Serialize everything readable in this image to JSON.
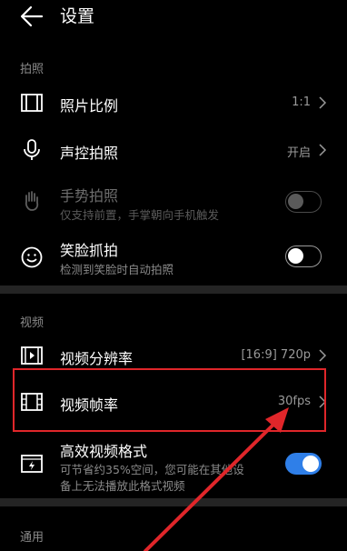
{
  "header": {
    "back_icon": "arrow-left-icon",
    "title": "设置"
  },
  "sections": {
    "photo": {
      "label": "拍照",
      "items": [
        {
          "icon": "aspect-ratio-icon",
          "title": "照片比例",
          "value": "1:1"
        },
        {
          "icon": "microphone-icon",
          "title": "声控拍照",
          "value": "开启"
        },
        {
          "icon": "gesture-hand-icon",
          "title": "手势拍照",
          "desc": "仅支持前置，手掌朝向手机触发",
          "toggle": "off",
          "disabled": true
        },
        {
          "icon": "smile-face-icon",
          "title": "笑脸抓拍",
          "desc": "检测到笑脸时自动拍照",
          "toggle": "off"
        }
      ]
    },
    "video": {
      "label": "视频",
      "items": [
        {
          "icon": "video-resolution-icon",
          "title": "视频分辨率",
          "value": "[16:9] 720p"
        },
        {
          "icon": "film-frame-icon",
          "title": "视频帧率",
          "value": "30fps"
        },
        {
          "icon": "efficient-format-icon",
          "title": "高效视频格式",
          "desc_line1": "可节省约35%空间，您可能在其他设",
          "desc_line2": "备上无法播放此格式视频",
          "toggle": "on"
        }
      ]
    },
    "general": {
      "label": "通用"
    }
  },
  "colors": {
    "background": "#000000",
    "divider": "#242424",
    "secondary_text": "#8a8a8a",
    "toggle_on": "#2f7fe8",
    "annotation_red": "#e0262a"
  }
}
